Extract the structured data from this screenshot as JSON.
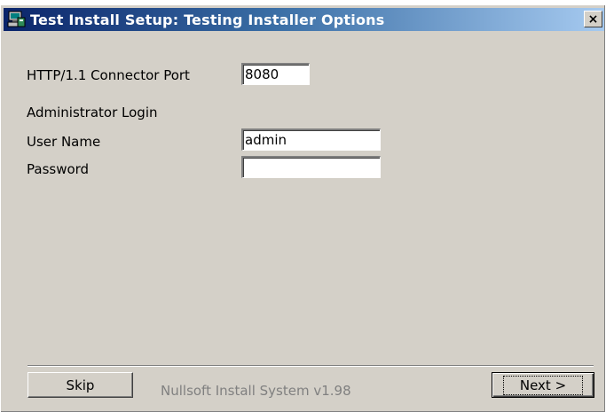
{
  "window": {
    "title": "Test Install Setup: Testing Installer Options",
    "close_label": "×"
  },
  "form": {
    "port_label": "HTTP/1.1 Connector Port",
    "port_value": "8080",
    "section_label": "Administrator Login",
    "username_label": "User Name",
    "username_value": "admin",
    "password_label": "Password",
    "password_value": ""
  },
  "footer": {
    "skip_label": "Skip",
    "branding": "Nullsoft Install System v1.98",
    "next_label": "Next >"
  },
  "colors": {
    "face": "#d4d0c8",
    "title_active": "#0a246a",
    "branding_text": "#808080"
  }
}
